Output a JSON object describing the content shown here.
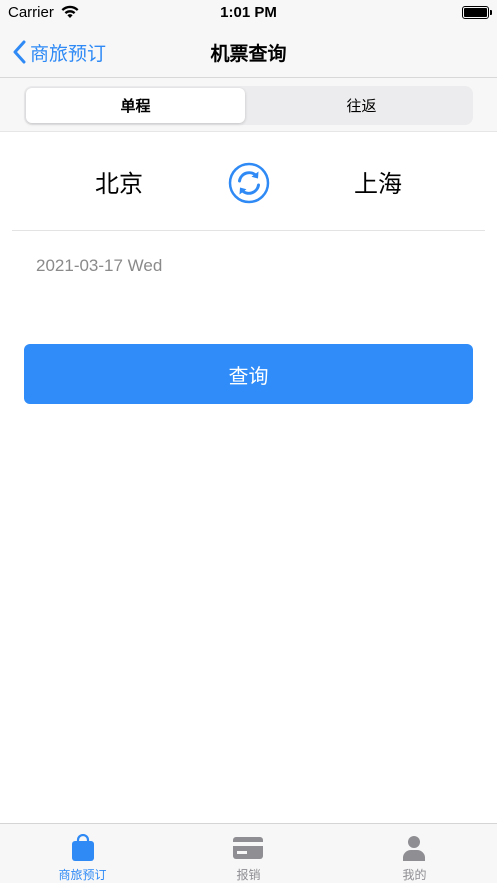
{
  "status_bar": {
    "carrier": "Carrier",
    "time": "1:01 PM"
  },
  "nav": {
    "back_label": "商旅预订",
    "title": "机票查询"
  },
  "segments": [
    {
      "label": "单程",
      "active": true
    },
    {
      "label": "往返",
      "active": false
    }
  ],
  "route": {
    "from": "北京",
    "to": "上海"
  },
  "date": "2021-03-17 Wed",
  "search_label": "查询",
  "tabs": [
    {
      "label": "商旅预订",
      "icon": "bag-icon",
      "active": true
    },
    {
      "label": "报销",
      "icon": "card-icon",
      "active": false
    },
    {
      "label": "我的",
      "icon": "person-icon",
      "active": false
    }
  ],
  "colors": {
    "accent": "#2f8af5",
    "button": "#2f8cf8",
    "inactive": "#8e8e93"
  }
}
